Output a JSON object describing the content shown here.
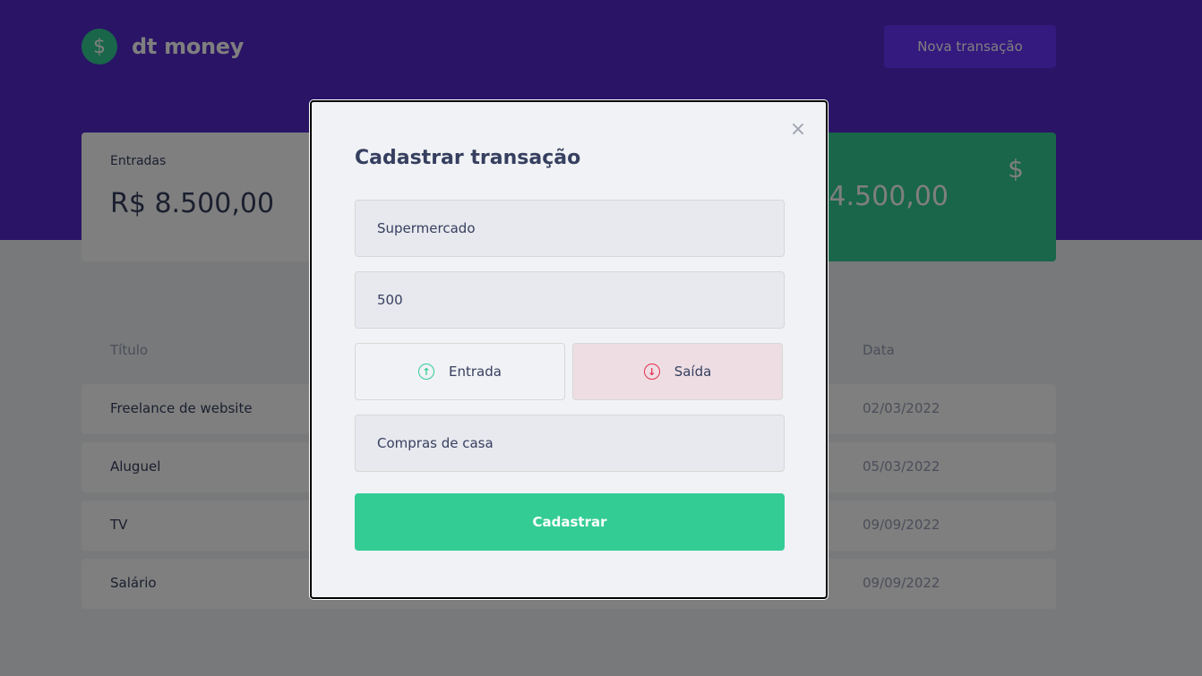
{
  "app": {
    "logo_text": "dt money",
    "new_transaction_label": "Nova transação"
  },
  "summary": {
    "income_label": "Entradas",
    "income_value": "R$ 8.500,00",
    "total_value_partial": "4.500,00"
  },
  "table": {
    "headers": {
      "title": "Título",
      "date": "Data"
    },
    "rows": [
      {
        "title": "Freelance de website",
        "date": "02/03/2022"
      },
      {
        "title": "Aluguel",
        "date": "05/03/2022"
      },
      {
        "title": "TV",
        "date": "09/09/2022"
      },
      {
        "title": "Salário",
        "date": "09/09/2022"
      }
    ]
  },
  "modal": {
    "title": "Cadastrar transação",
    "close_symbol": "×",
    "title_input_value": "Supermercado",
    "amount_input_value": "500",
    "income_type_label": "Entrada",
    "outcome_type_label": "Saída",
    "category_input_value": "Compras de casa",
    "submit_label": "Cadastrar",
    "selected_type": "Saída"
  },
  "icons": {
    "logo": "dollar-icon",
    "total": "dollar-icon",
    "income": "arrow-up-circle-icon",
    "outcome": "arrow-down-circle-icon",
    "close": "close-icon"
  },
  "colors": {
    "header": "#5429cc",
    "green": "#33cc95",
    "red": "#e52e4d",
    "button": "#6933ff"
  }
}
